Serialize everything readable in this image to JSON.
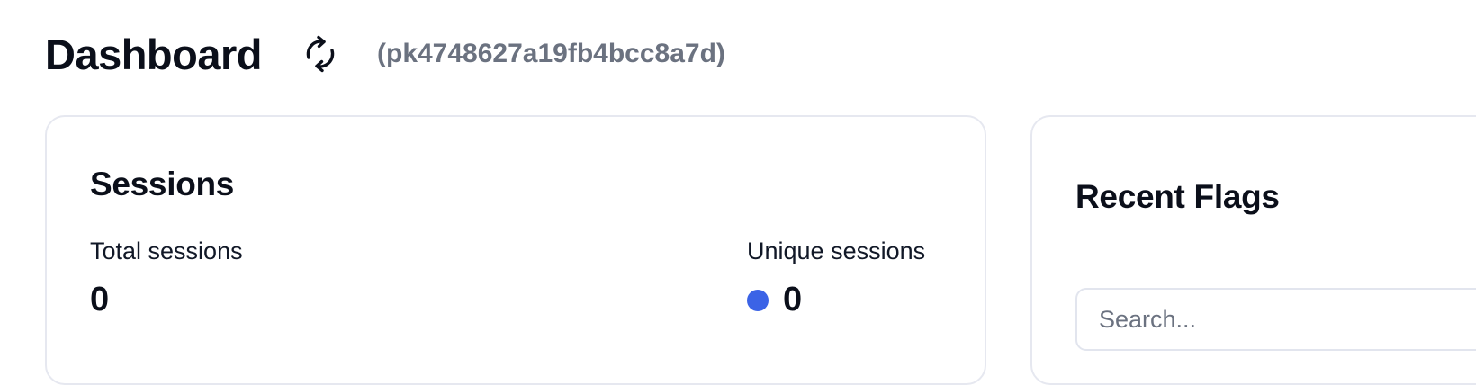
{
  "header": {
    "title": "Dashboard",
    "refresh_icon": "refresh-icon",
    "project_id": "(pk4748627a19fb4bcc8a7d)"
  },
  "sessions": {
    "title": "Sessions",
    "total_label": "Total sessions",
    "total_value": "0",
    "unique_label": "Unique sessions",
    "unique_value": "0",
    "unique_dot_color": "#3b63e6"
  },
  "flags": {
    "title": "Recent Flags",
    "search_placeholder": "Search...",
    "search_value": ""
  }
}
